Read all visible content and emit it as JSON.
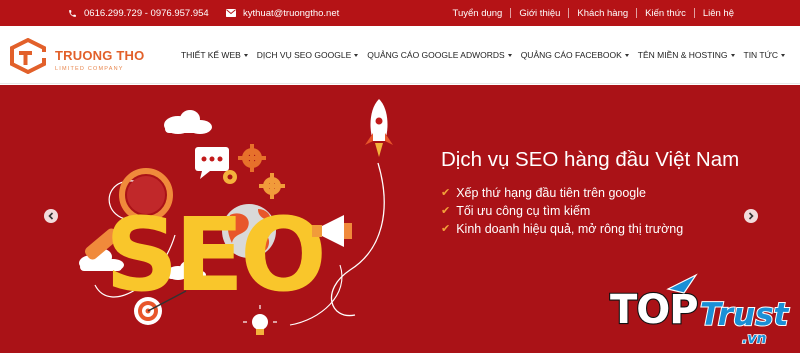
{
  "topbar": {
    "phone": "0616.299.729 - 0976.957.954",
    "email": "kythuat@truongtho.net",
    "links": [
      "Tuyển dụng",
      "Giới thiệu",
      "Khách hàng",
      "Kiến thức",
      "Liên hệ"
    ]
  },
  "brand": {
    "name": "TRUONG THO",
    "tagline": "LIMITED COMPANY"
  },
  "menu": [
    "THIẾT KẾ WEB",
    "DỊCH VỤ SEO GOOGLE",
    "QUẢNG CÁO GOOGLE ADWORDS",
    "QUẢNG CÁO FACEBOOK",
    "TÊN MIỀN & HOSTING",
    "TIN TỨC"
  ],
  "hero": {
    "art_text": "SEO",
    "title": "Dịch vụ SEO hàng đầu Việt Nam",
    "bullets": [
      "Xếp thứ hạng đầu tiên trên google",
      "Tối ưu công cụ tìm kiếm",
      "Kinh doanh hiệu quả, mở rông thị trường"
    ]
  },
  "watermark": {
    "word1": "TOP",
    "word2": "Trust",
    "suffix": ".vn"
  },
  "icons": {
    "phone": "phone-icon",
    "email": "envelope-icon",
    "check": "check-icon",
    "prev": "chevron-left-icon",
    "next": "chevron-right-icon"
  },
  "colors": {
    "topbar": "#b51316",
    "hero": "#aa1217",
    "brand": "#e2602a",
    "accent_yellow": "#f9c62b",
    "check": "#f3a23a"
  }
}
